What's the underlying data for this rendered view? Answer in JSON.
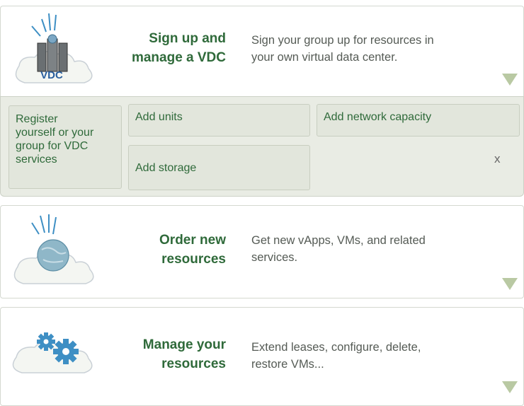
{
  "sections": [
    {
      "id": "vdc",
      "title": "Sign up and\nmanage a VDC",
      "description": "Sign your group up for  resources in\nyour own virtual data center.",
      "icon": "vdc-cloud-server-icon",
      "badge": "VDC"
    },
    {
      "id": "order",
      "title": "Order new\nresources",
      "description": "Get new vApps, VMs, and related\nservices.",
      "icon": "globe-cloud-icon"
    },
    {
      "id": "manage",
      "title": "Manage your\nresources",
      "description": "Extend leases, configure, delete,\nrestore VMs...",
      "icon": "gears-cloud-icon"
    }
  ],
  "actions": {
    "register": "Register\nyourself or your\ngroup for VDC\nservices",
    "add_units": "Add units",
    "add_network": "Add network capacity",
    "add_storage": "Add storage",
    "close": "x"
  },
  "colors": {
    "title_green": "#2f6a3a",
    "arrow": "#b9c9a3",
    "panel_bg": "#e9ece4"
  }
}
